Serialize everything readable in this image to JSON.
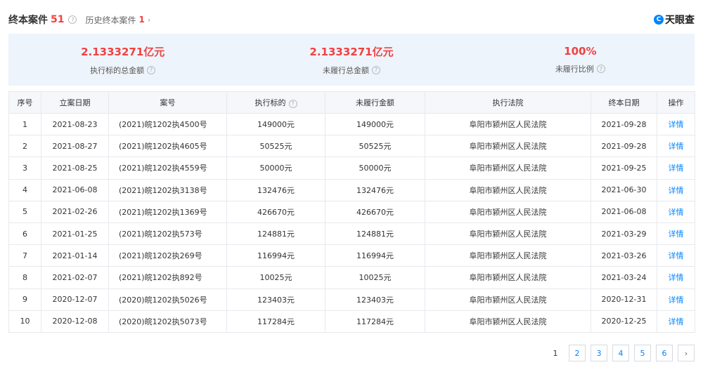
{
  "header": {
    "title": "终本案件",
    "count": "51",
    "history_label": "历史终本案件",
    "history_count": "1",
    "logo_text": "天眼查"
  },
  "summary": [
    {
      "value": "2.1333271亿元",
      "label": "执行标的总金额"
    },
    {
      "value": "2.1333271亿元",
      "label": "未履行总金额"
    },
    {
      "value": "100%",
      "label": "未履行比例"
    }
  ],
  "table": {
    "columns": [
      "序号",
      "立案日期",
      "案号",
      "执行标的",
      "未履行金额",
      "执行法院",
      "终本日期",
      "操作"
    ],
    "rows": [
      [
        "1",
        "2021-08-23",
        "(2021)皖1202执4500号",
        "149000元",
        "149000元",
        "阜阳市颍州区人民法院",
        "2021-09-28",
        "详情"
      ],
      [
        "2",
        "2021-08-27",
        "(2021)皖1202执4605号",
        "50525元",
        "50525元",
        "阜阳市颍州区人民法院",
        "2021-09-28",
        "详情"
      ],
      [
        "3",
        "2021-08-25",
        "(2021)皖1202执4559号",
        "50000元",
        "50000元",
        "阜阳市颍州区人民法院",
        "2021-09-25",
        "详情"
      ],
      [
        "4",
        "2021-06-08",
        "(2021)皖1202执3138号",
        "132476元",
        "132476元",
        "阜阳市颍州区人民法院",
        "2021-06-30",
        "详情"
      ],
      [
        "5",
        "2021-02-26",
        "(2021)皖1202执1369号",
        "426670元",
        "426670元",
        "阜阳市颍州区人民法院",
        "2021-06-08",
        "详情"
      ],
      [
        "6",
        "2021-01-25",
        "(2021)皖1202执573号",
        "124881元",
        "124881元",
        "阜阳市颍州区人民法院",
        "2021-03-29",
        "详情"
      ],
      [
        "7",
        "2021-01-14",
        "(2021)皖1202执269号",
        "116994元",
        "116994元",
        "阜阳市颍州区人民法院",
        "2021-03-26",
        "详情"
      ],
      [
        "8",
        "2021-02-07",
        "(2021)皖1202执892号",
        "10025元",
        "10025元",
        "阜阳市颍州区人民法院",
        "2021-03-24",
        "详情"
      ],
      [
        "9",
        "2020-12-07",
        "(2020)皖1202执5026号",
        "123403元",
        "123403元",
        "阜阳市颍州区人民法院",
        "2020-12-31",
        "详情"
      ],
      [
        "10",
        "2020-12-08",
        "(2020)皖1202执5073号",
        "117284元",
        "117284元",
        "阜阳市颍州区人民法院",
        "2020-12-25",
        "详情"
      ]
    ]
  },
  "pagination": {
    "pages": [
      "1",
      "2",
      "3",
      "4",
      "5",
      "6"
    ],
    "current": "1",
    "next": "›"
  },
  "icons": {
    "help": "?",
    "chevron": "›",
    "logo_mark": "C"
  }
}
